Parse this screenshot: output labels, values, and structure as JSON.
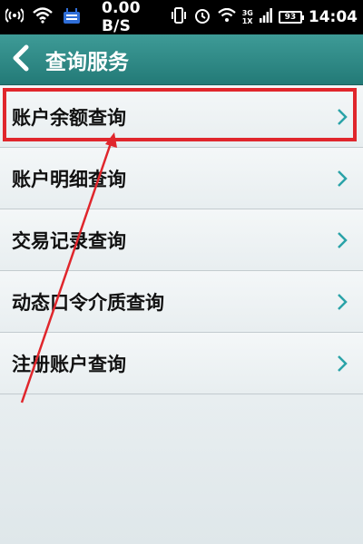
{
  "status_bar": {
    "speed": "0.00 B/S",
    "network_top": "3G",
    "network_bottom": "1X",
    "battery": "93",
    "time": "14:04"
  },
  "header": {
    "title": "查询服务",
    "back_icon": "chevron-left-icon"
  },
  "menu": {
    "items": [
      {
        "label": "账户余额查询",
        "icon": "chevron-right-icon"
      },
      {
        "label": "账户明细查询",
        "icon": "chevron-right-icon"
      },
      {
        "label": "交易记录查询",
        "icon": "chevron-right-icon"
      },
      {
        "label": "动态口令介质查询",
        "icon": "chevron-right-icon"
      },
      {
        "label": "注册账户查询",
        "icon": "chevron-right-icon"
      }
    ]
  },
  "colors": {
    "header": "#2e8a86",
    "chevron": "#2aa3a8",
    "highlight": "#e0262c"
  }
}
